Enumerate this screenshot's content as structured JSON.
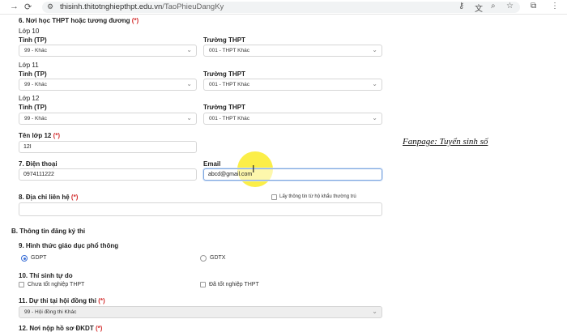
{
  "browser": {
    "url_host": "thisinh.thitotnghiepthpt.edu.vn",
    "url_path": "/TaoPhieuDangKy",
    "back_icon": "arrow-left",
    "reload_icon": "reload"
  },
  "section6": {
    "title": "6. Nơi học THPT hoặc tương đương",
    "required_mark": "(*)",
    "rows": [
      {
        "grade_label": "Lớp 10",
        "province_label": "Tỉnh (TP)",
        "province_value": "99 - Khác",
        "school_label": "Trường THPT",
        "school_value": "001 - THPT Khác"
      },
      {
        "grade_label": "Lớp 11",
        "province_label": "Tỉnh (TP)",
        "province_value": "99 - Khác",
        "school_label": "Trường THPT",
        "school_value": "001 - THPT Khác"
      },
      {
        "grade_label": "Lớp 12",
        "province_label": "Tỉnh (TP)",
        "province_value": "99 - Khác",
        "school_label": "Trường THPT",
        "school_value": "001 - THPT Khác"
      }
    ]
  },
  "class12": {
    "label": "Tên lớp 12",
    "required_mark": "(*)",
    "value": "12I"
  },
  "contact": {
    "phone_label": "7. Điện thoại",
    "phone_value": "0974111222",
    "email_label": "Email",
    "email_value": "abcd@gmail.com"
  },
  "address": {
    "label": "8. Địa chỉ liên hệ",
    "required_mark": "(*)",
    "copy_checkbox_label": "Lấy thông tin từ hộ khẩu thường trú"
  },
  "sectionB": {
    "title": "B. Thông tin đăng ký thi"
  },
  "education": {
    "label": "9. Hình thức giáo dục phổ thông",
    "options": [
      "GDPT",
      "GDTX"
    ],
    "selected": "GDPT"
  },
  "free_candidate": {
    "label": "10. Thí sinh tự do",
    "options": [
      "Chưa tốt nghiệp THPT",
      "Đã tốt nghiệp THPT"
    ]
  },
  "exam_council": {
    "label": "11. Dự thi tại hội đồng thi",
    "required_mark": "(*)",
    "value": "99 - Hội đồng thi Khác"
  },
  "submit_place": {
    "label": "12. Nơi nộp hồ sơ ĐKDT",
    "required_mark": "(*)"
  },
  "overlay": {
    "fanpage_text": "Fanpage: Tuyển sinh số"
  }
}
